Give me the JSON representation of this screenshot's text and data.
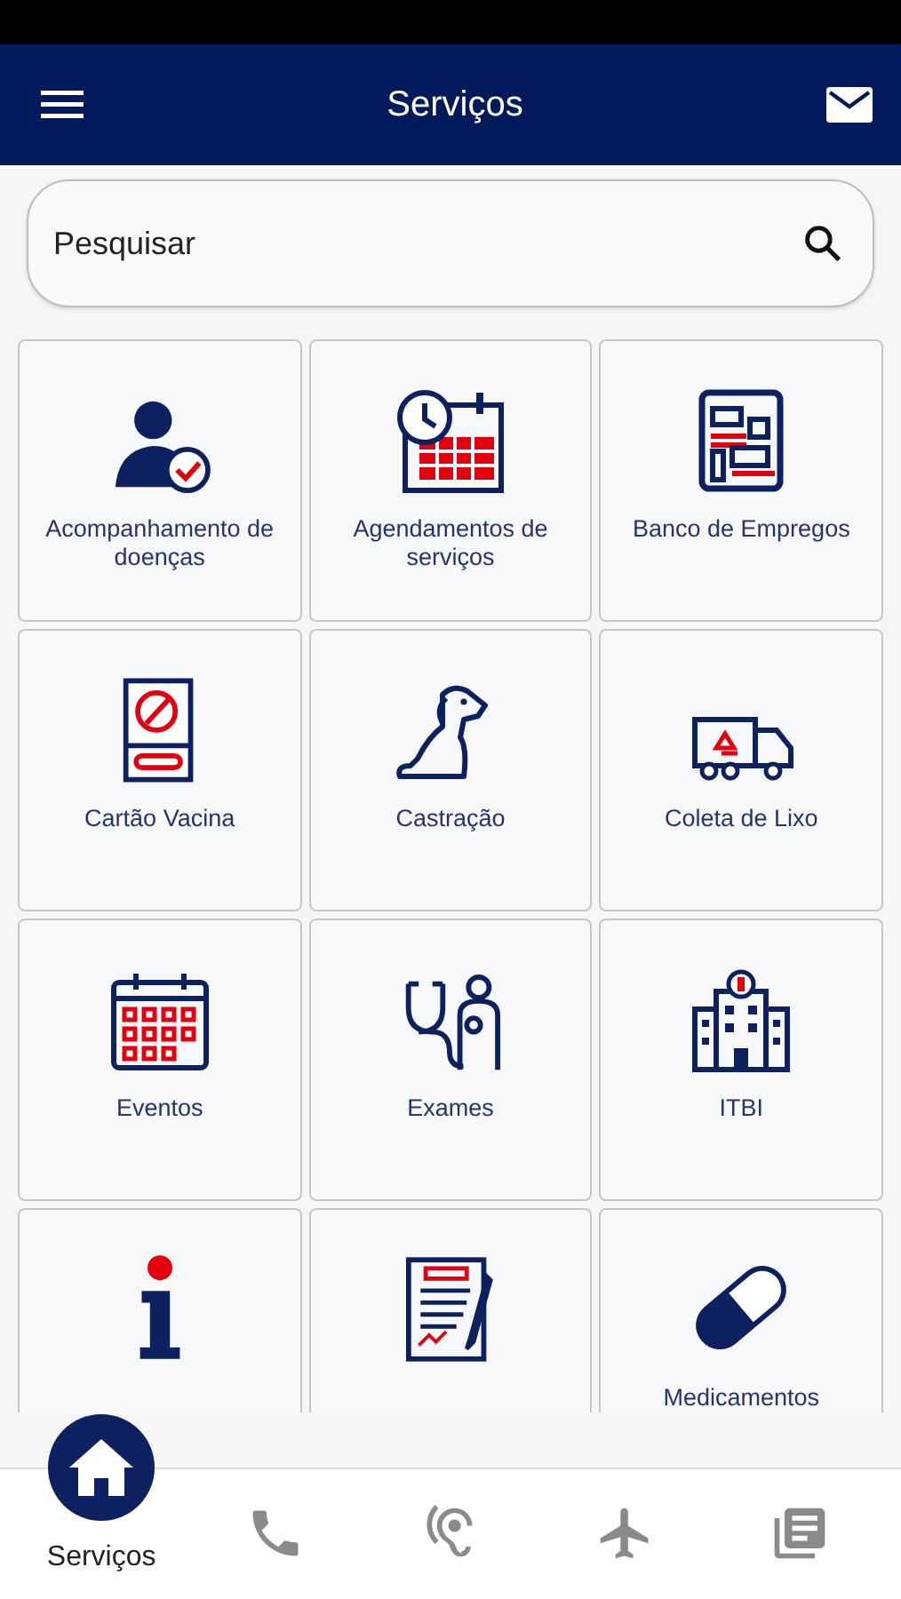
{
  "header": {
    "title": "Serviços"
  },
  "search": {
    "placeholder": "Pesquisar"
  },
  "services": [
    {
      "kind": "labeled",
      "label": "Acompanhamento de doenças"
    },
    {
      "kind": "labeled",
      "label": "Agendamentos de serviços"
    },
    {
      "kind": "labeled",
      "label": "Banco de Empregos"
    },
    {
      "kind": "labeled",
      "label": "Cartão Vacina"
    },
    {
      "kind": "labeled",
      "label": "Castração"
    },
    {
      "kind": "labeled",
      "label": "Coleta de Lixo"
    },
    {
      "kind": "labeled",
      "label": "Eventos"
    },
    {
      "kind": "labeled",
      "label": "Exames"
    },
    {
      "kind": "labeled",
      "label": "ITBI"
    },
    {
      "kind": "unlabeled"
    },
    {
      "kind": "unlabeled"
    },
    {
      "kind": "labeled",
      "label": "Medicamentos"
    }
  ],
  "bottom_nav": [
    {
      "label": "Serviços",
      "selected": true
    },
    {
      "selected": false
    },
    {
      "selected": false
    },
    {
      "selected": false
    },
    {
      "selected": false
    }
  ]
}
